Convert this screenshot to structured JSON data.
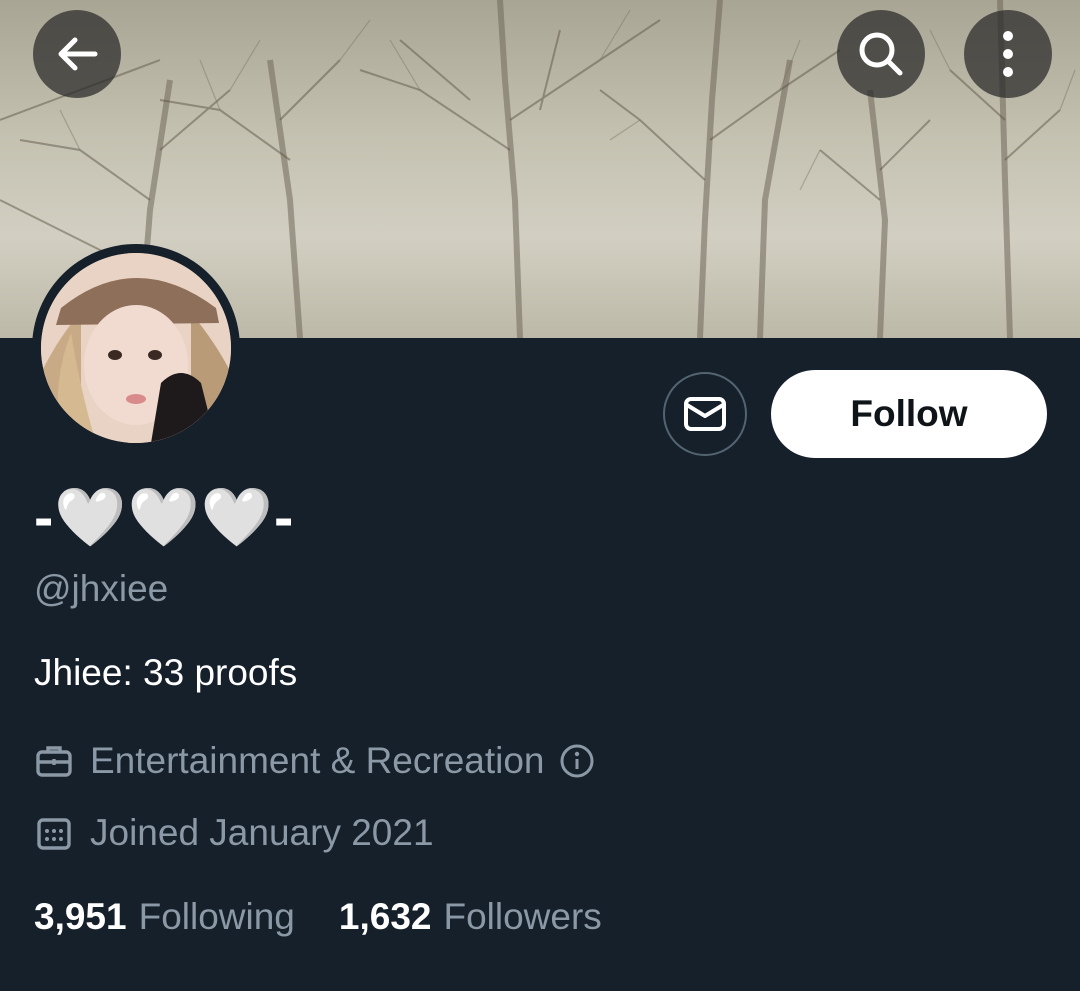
{
  "header": {
    "back_icon": "arrow-left-icon",
    "search_icon": "search-icon",
    "more_icon": "more-vertical-icon"
  },
  "profile": {
    "display_name": "-🤍🤍🤍-",
    "handle": "@jhxiee",
    "bio": "Jhiee: 33 proofs",
    "category": "Entertainment & Recreation",
    "joined": "Joined January 2021"
  },
  "actions": {
    "follow_label": "Follow",
    "message_icon": "envelope-icon"
  },
  "stats": {
    "following_count": "3,951",
    "following_label": "Following",
    "followers_count": "1,632",
    "followers_label": "Followers"
  },
  "colors": {
    "background": "#15202b",
    "secondary_text": "#8b98a5",
    "follow_button": "#ffffff"
  }
}
